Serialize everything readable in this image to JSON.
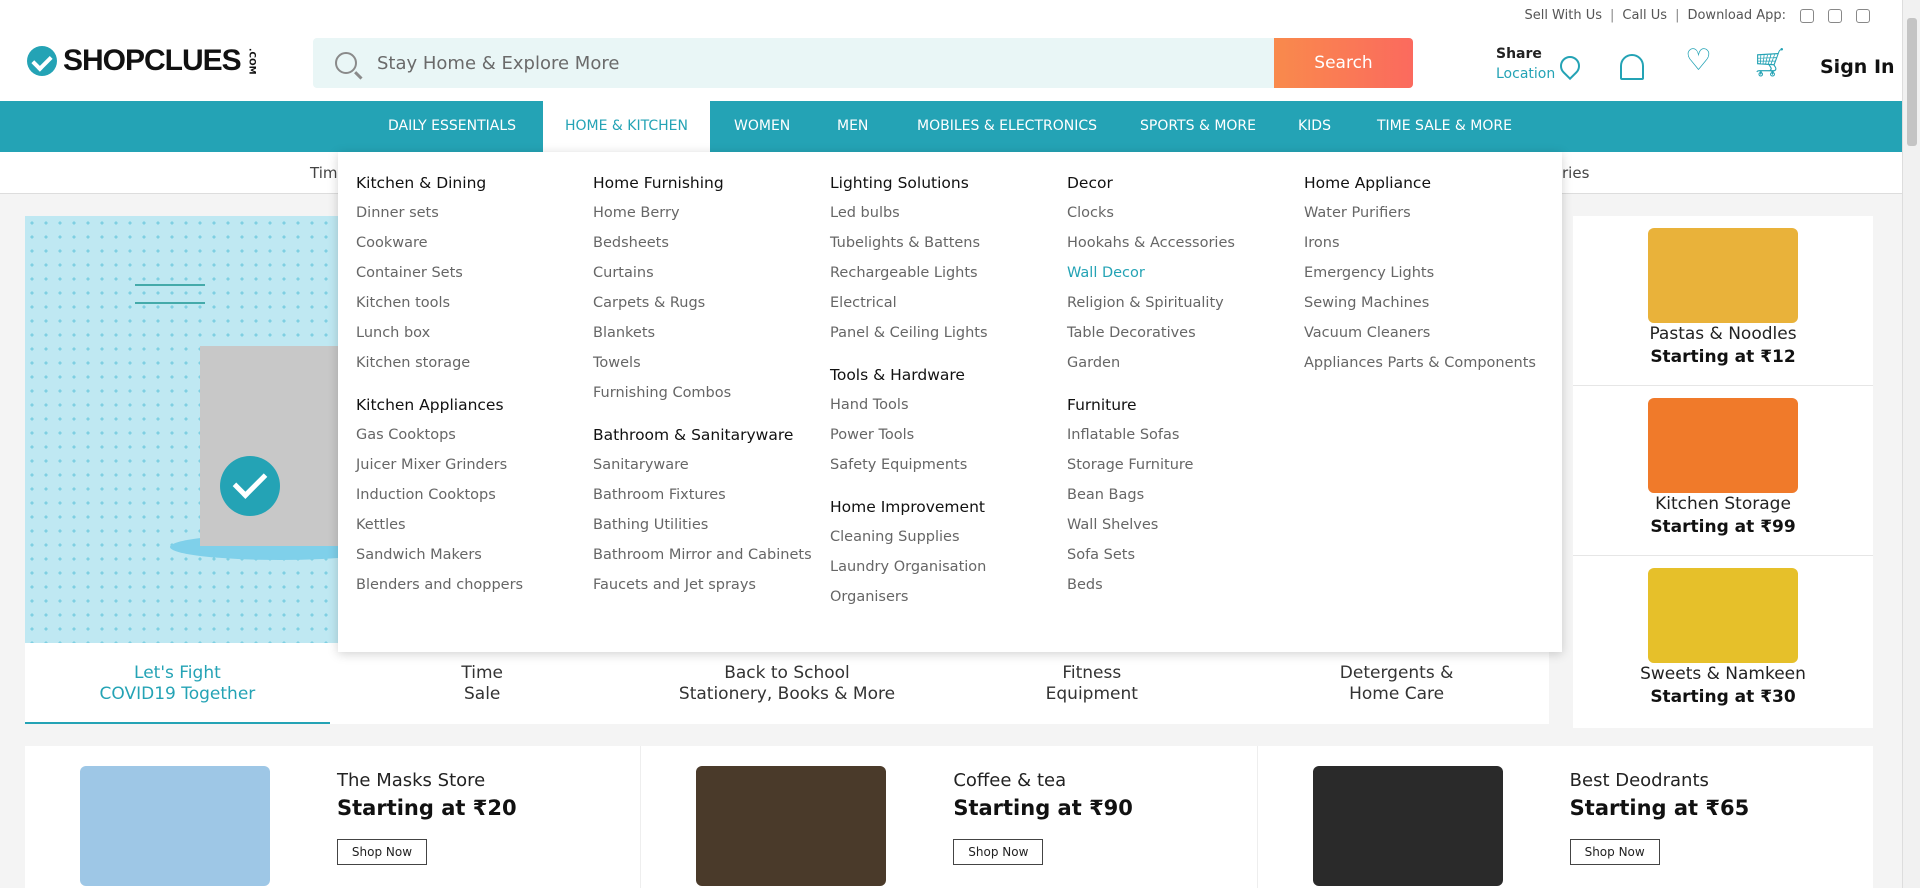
{
  "util_bar": {
    "sell": "Sell With Us",
    "call": "Call Us",
    "download": "Download App:",
    "sep": "|"
  },
  "header": {
    "logo_text": "SHOPCLUES",
    "logo_suffix": ".COM",
    "search_placeholder": "Stay Home & Explore More",
    "search_button": "Search",
    "share_line1": "Share",
    "share_line2": "Location",
    "sign_in": "Sign In"
  },
  "nav": {
    "items": [
      "DAILY ESSENTIALS",
      "HOME & KITCHEN",
      "WOMEN",
      "MEN",
      "MOBILES & ELECTRONICS",
      "SPORTS & MORE",
      "KIDS",
      "TIME SALE & MORE"
    ],
    "active": "HOME & KITCHEN"
  },
  "subnav": {
    "left": "Tim",
    "right": "ries"
  },
  "mega_menu": {
    "columns": [
      {
        "groups": [
          {
            "title": "Kitchen & Dining",
            "links": [
              "Dinner sets",
              "Cookware",
              "Container Sets",
              "Kitchen tools",
              "Lunch box",
              "Kitchen storage"
            ]
          },
          {
            "title": "Kitchen Appliances",
            "links": [
              "Gas Cooktops",
              "Juicer Mixer Grinders",
              "Induction Cooktops",
              "Kettles",
              "Sandwich Makers",
              "Blenders and choppers"
            ]
          }
        ]
      },
      {
        "groups": [
          {
            "title": "Home Furnishing",
            "links": [
              "Home Berry",
              "Bedsheets",
              "Curtains",
              "Carpets & Rugs",
              "Blankets",
              "Towels",
              "Furnishing Combos"
            ]
          },
          {
            "title": "Bathroom & Sanitaryware",
            "links": [
              "Sanitaryware",
              "Bathroom Fixtures",
              "Bathing Utilities",
              "Bathroom Mirror and Cabinets",
              "Faucets and Jet sprays"
            ]
          }
        ]
      },
      {
        "groups": [
          {
            "title": "Lighting Solutions",
            "links": [
              "Led bulbs",
              "Tubelights & Battens",
              "Rechargeable Lights",
              "Electrical",
              "Panel & Ceiling Lights"
            ]
          },
          {
            "title": "Tools & Hardware",
            "links": [
              "Hand Tools",
              "Power Tools",
              "Safety Equipments"
            ]
          },
          {
            "title": "Home Improvement",
            "links": [
              "Cleaning Supplies",
              "Laundry Organisation",
              "Organisers"
            ]
          }
        ]
      },
      {
        "groups": [
          {
            "title": "Decor",
            "links": [
              "Clocks",
              "Hookahs & Accessories",
              "Wall Decor",
              "Religion & Spirituality",
              "Table Decoratives",
              "Garden"
            ]
          },
          {
            "title": "Furniture",
            "links": [
              "Inflatable Sofas",
              "Storage Furniture",
              "Bean Bags",
              "Wall Shelves",
              "Sofa Sets",
              "Beds"
            ]
          }
        ]
      },
      {
        "groups": [
          {
            "title": "Home Appliance",
            "links": [
              "Water Purifiers",
              "Irons",
              "Emergency Lights",
              "Sewing Machines",
              "Vacuum Cleaners",
              "Appliances Parts & Components"
            ]
          }
        ]
      }
    ],
    "highlighted": "Wall Decor"
  },
  "banner_tabs": [
    {
      "line1": "Let's Fight",
      "line2": "COVID19 Together"
    },
    {
      "line1": "Time",
      "line2": "Sale"
    },
    {
      "line1": "Back to School",
      "line2": "Stationery, Books & More"
    },
    {
      "line1": "Fitness",
      "line2": "Equipment"
    },
    {
      "line1": "Detergents &",
      "line2": "Home Care"
    }
  ],
  "right_cards": [
    {
      "title": "Pastas & Noodles",
      "price": "Starting at ₹12",
      "color": "#e9b23a"
    },
    {
      "title": "Kitchen Storage",
      "price": "Starting at ₹99",
      "color": "#f07a2a"
    },
    {
      "title": "Sweets & Namkeen",
      "price": "Starting at ₹30",
      "color": "#e6c02a"
    }
  ],
  "promos": [
    {
      "title": "The Masks Store",
      "price": "Starting at ₹20",
      "button": "Shop Now",
      "color": "#9ec7e6"
    },
    {
      "title": "Coffee & tea",
      "price": "Starting at ₹90",
      "button": "Shop Now",
      "color": "#4a3a2a"
    },
    {
      "title": "Best Deodrants",
      "price": "Starting at ₹65",
      "button": "Shop Now",
      "color": "#2a2a2a"
    }
  ],
  "colors": {
    "brand": "#24a3b5",
    "search_btn": "#fb6a5e"
  }
}
